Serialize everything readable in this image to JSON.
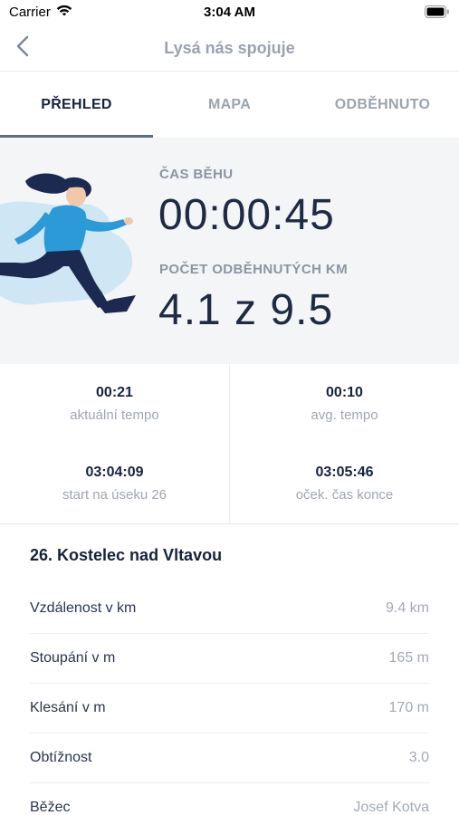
{
  "status_bar": {
    "carrier": "Carrier",
    "time": "3:04 AM"
  },
  "nav": {
    "title": "Lysá nás spojuje",
    "back_icon": "chevron-left-icon"
  },
  "tabs": [
    {
      "label": "PŘEHLED",
      "active": true
    },
    {
      "label": "MAPA",
      "active": false
    },
    {
      "label": "ODBĚHNUTO",
      "active": false
    }
  ],
  "hero": {
    "time_label": "ČAS BĚHU",
    "time_value": "00:00:45",
    "km_label": "POČET ODBĚHNUTÝCH KM",
    "km_done": "4.1",
    "km_sep": "z",
    "km_total": "9.5"
  },
  "stats": [
    {
      "value": "00:21",
      "label": "aktuální tempo"
    },
    {
      "value": "00:10",
      "label": "avg. tempo"
    },
    {
      "value": "03:04:09",
      "label": "start na úseku 26"
    },
    {
      "value": "03:05:46",
      "label": "oček. čas konce"
    }
  ],
  "section": {
    "title": "26. Kostelec nad Vltavou",
    "rows": [
      {
        "label": "Vzdálenost v km",
        "value": "9.4 km"
      },
      {
        "label": "Stoupání v m",
        "value": "165 m"
      },
      {
        "label": "Klesání v m",
        "value": "170 m"
      },
      {
        "label": "Obtížnost",
        "value": "3.0"
      },
      {
        "label": "Běžec",
        "value": "Josef Kotva"
      }
    ]
  },
  "colors": {
    "accent": "#16233d",
    "muted": "#9aa3b0",
    "hero_bg": "#f3f5f7",
    "runner_blue": "#2d9ad8",
    "runner_navy": "#1c2a52"
  }
}
